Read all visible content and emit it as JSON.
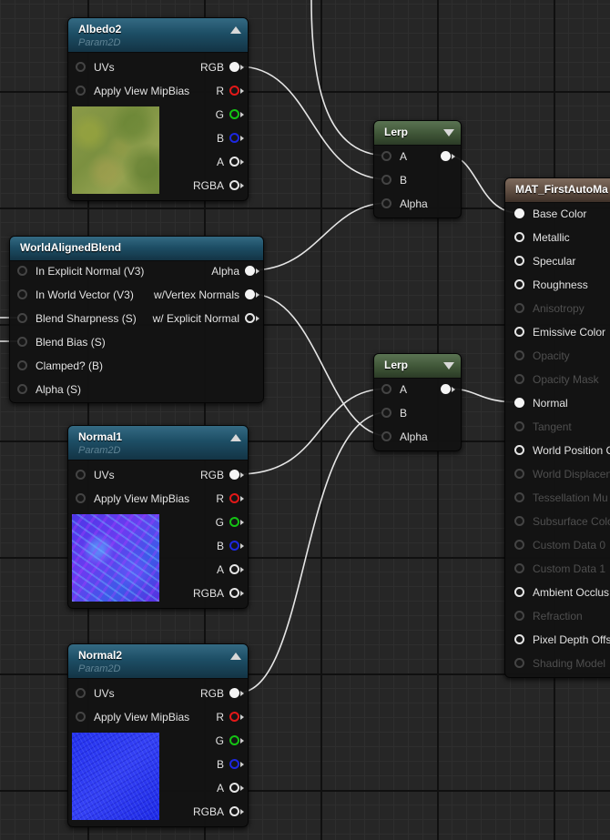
{
  "nodes": {
    "albedo2": {
      "title": "Albedo2",
      "subtitle": "Param2D",
      "inputs": [
        "UVs",
        "Apply View MipBias"
      ],
      "outputs": [
        "RGB",
        "R",
        "G",
        "B",
        "A",
        "RGBA"
      ]
    },
    "lerp1": {
      "title": "Lerp",
      "inputs": [
        "A",
        "B",
        "Alpha"
      ]
    },
    "world_aligned_blend": {
      "title": "WorldAlignedBlend",
      "inputs": [
        "In Explicit Normal (V3)",
        "In World Vector (V3)",
        "Blend Sharpness (S)",
        "Blend Bias (S)",
        "Clamped? (B)",
        "Alpha (S)"
      ],
      "outputs": [
        "Alpha",
        "w/Vertex Normals",
        "w/ Explicit Normal"
      ]
    },
    "lerp2": {
      "title": "Lerp",
      "inputs": [
        "A",
        "B",
        "Alpha"
      ]
    },
    "normal1": {
      "title": "Normal1",
      "subtitle": "Param2D",
      "inputs": [
        "UVs",
        "Apply View MipBias"
      ],
      "outputs": [
        "RGB",
        "R",
        "G",
        "B",
        "A",
        "RGBA"
      ]
    },
    "normal2": {
      "title": "Normal2",
      "subtitle": "Param2D",
      "inputs": [
        "UVs",
        "Apply View MipBias"
      ],
      "outputs": [
        "RGB",
        "R",
        "G",
        "B",
        "A",
        "RGBA"
      ]
    },
    "material": {
      "title": "MAT_FirstAutoMa",
      "inputs": [
        "Base Color",
        "Metallic",
        "Specular",
        "Roughness",
        "Anisotropy",
        "Emissive Color",
        "Opacity",
        "Opacity Mask",
        "Normal",
        "Tangent",
        "World Position C",
        "World Displacen",
        "Tessellation Mu",
        "Subsurface Colo",
        "Custom Data 0",
        "Custom Data 1",
        "Ambient Occlus",
        "Refraction",
        "Pixel Depth Offs",
        "Shading Model"
      ]
    }
  },
  "colors": {
    "canvas": "#262626",
    "texture_header": "#1d4e65",
    "lerp_header": "#3f5537",
    "material_header": "#5d4c40",
    "wire": "#e6e6e6",
    "pin_red": "#e41818",
    "pin_green": "#14c414",
    "pin_blue": "#1d28e0"
  }
}
